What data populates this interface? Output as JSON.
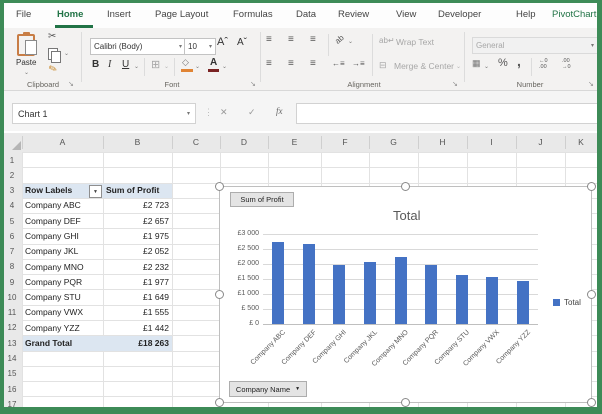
{
  "window": {
    "frame_color": "#3d8b57",
    "accent_green": "#217346"
  },
  "ribbon": {
    "tabs": [
      {
        "label": "File"
      },
      {
        "label": "Home",
        "active": true
      },
      {
        "label": "Insert"
      },
      {
        "label": "Page Layout"
      },
      {
        "label": "Formulas"
      },
      {
        "label": "Data"
      },
      {
        "label": "Review"
      },
      {
        "label": "View"
      },
      {
        "label": "Developer"
      },
      {
        "label": "Help"
      },
      {
        "label": "PivotChart",
        "contextual": true
      }
    ],
    "clipboard": {
      "label": "Clipboard",
      "paste_label": "Paste"
    },
    "font": {
      "label": "Font",
      "font_name": "Calibri (Body)",
      "font_size": "10",
      "bold": "B",
      "italic": "I",
      "underline": "U"
    },
    "alignment": {
      "label": "Alignment",
      "wrap_text": "Wrap Text",
      "merge_center": "Merge & Center"
    },
    "number": {
      "label": "Number",
      "format": "General",
      "percent": "%",
      "comma": ","
    }
  },
  "formula_bar": {
    "name_box": "Chart 1",
    "fx": "fx",
    "cancel": "✕",
    "enter": "✓"
  },
  "grid": {
    "columns": [
      "A",
      "B",
      "C",
      "D",
      "E",
      "F",
      "G",
      "H",
      "I",
      "J",
      "K"
    ],
    "rows": [
      "1",
      "2",
      "3",
      "4",
      "5",
      "6",
      "7",
      "8",
      "9",
      "10",
      "11",
      "12",
      "13",
      "14",
      "15",
      "16",
      "17"
    ]
  },
  "pivot": {
    "header": {
      "label": "Row Labels",
      "value": "Sum of Profit"
    },
    "rows": [
      {
        "label": "Company ABC",
        "value": "£2 723"
      },
      {
        "label": "Company DEF",
        "value": "£2 657"
      },
      {
        "label": "Company GHI",
        "value": "£1 975"
      },
      {
        "label": "Company JKL",
        "value": "£2 052"
      },
      {
        "label": "Company MNO",
        "value": "£2 232"
      },
      {
        "label": "Company PQR",
        "value": "£1 977"
      },
      {
        "label": "Company STU",
        "value": "£1 649"
      },
      {
        "label": "Company VWX",
        "value": "£1 555"
      },
      {
        "label": "Company YZZ",
        "value": "£1 442"
      }
    ],
    "total": {
      "label": "Grand Total",
      "value": "£18 263"
    }
  },
  "chart_data": {
    "type": "bar",
    "title": "Total",
    "categories": [
      "Company ABC",
      "Company DEF",
      "Company GHI",
      "Company JKL",
      "Company MNO",
      "Company PQR",
      "Company STU",
      "Company VWX",
      "Company YZZ"
    ],
    "values": [
      2723,
      2657,
      1975,
      2052,
      2232,
      1977,
      1649,
      1555,
      1442
    ],
    "series_name": "Total",
    "legend": "Total",
    "legend_position": "right",
    "ylim": [
      0,
      3000
    ],
    "y_ticks": [
      "£3 000",
      "£2 500",
      "£2 000",
      "£1 500",
      "£1 000",
      "£ 500",
      "£ 0"
    ],
    "grid": true,
    "bar_color": "#4472C4",
    "field_buttons": {
      "value": "Sum of Profit",
      "axis": "Company Name"
    }
  }
}
